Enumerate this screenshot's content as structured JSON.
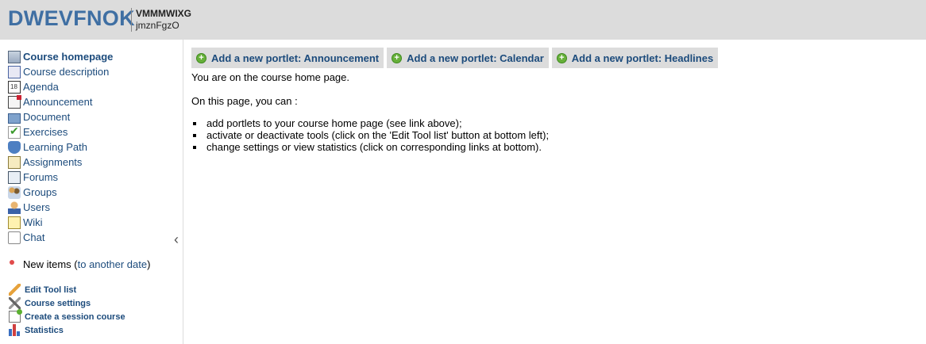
{
  "header": {
    "course_code": "DWEVFNOK",
    "course_title": "VMMMWIXG",
    "titular": "jmznFgzO"
  },
  "sidebar": {
    "tools": [
      {
        "label": "Course homepage",
        "icon": "home-icon",
        "active": true
      },
      {
        "label": "Course description",
        "icon": "description-icon"
      },
      {
        "label": "Agenda",
        "icon": "calendar-icon"
      },
      {
        "label": "Announcement",
        "icon": "announcement-icon"
      },
      {
        "label": "Document",
        "icon": "folder-icon"
      },
      {
        "label": "Exercises",
        "icon": "checkmark-icon"
      },
      {
        "label": "Learning Path",
        "icon": "learning-path-icon"
      },
      {
        "label": "Assignments",
        "icon": "assignment-icon"
      },
      {
        "label": "Forums",
        "icon": "forum-icon"
      },
      {
        "label": "Groups",
        "icon": "groups-icon"
      },
      {
        "label": "Users",
        "icon": "user-icon"
      },
      {
        "label": "Wiki",
        "icon": "wiki-icon"
      },
      {
        "label": "Chat",
        "icon": "chat-icon"
      }
    ],
    "new_items": {
      "prefix": "New items (",
      "link": "to another date",
      "suffix": ")"
    },
    "admin": [
      {
        "label": "Edit Tool list",
        "icon": "pencil-icon"
      },
      {
        "label": "Course settings",
        "icon": "tools-icon"
      },
      {
        "label": "Create a session course",
        "icon": "session-course-icon"
      },
      {
        "label": "Statistics",
        "icon": "statistics-icon"
      }
    ],
    "collapse_arrow": "‹"
  },
  "main": {
    "portlet_buttons": [
      "Add a new portlet: Announcement",
      "Add a new portlet: Calendar",
      "Add a new portlet: Headlines"
    ],
    "intro": "You are on the course home page.",
    "on_page": "On this page, you can :",
    "bullets": [
      "add portlets to your course home page (see link above);",
      "activate or deactivate tools (click on the 'Edit Tool list' button at bottom left);",
      "change settings or view statistics (click on corresponding links at bottom)."
    ]
  },
  "colors": {
    "accent": "#3f6fa3",
    "link": "#1c4b7c",
    "header_bg": "#dcdcdc",
    "plus_green": "#67b03a",
    "new_dot": "#e14b4b"
  }
}
